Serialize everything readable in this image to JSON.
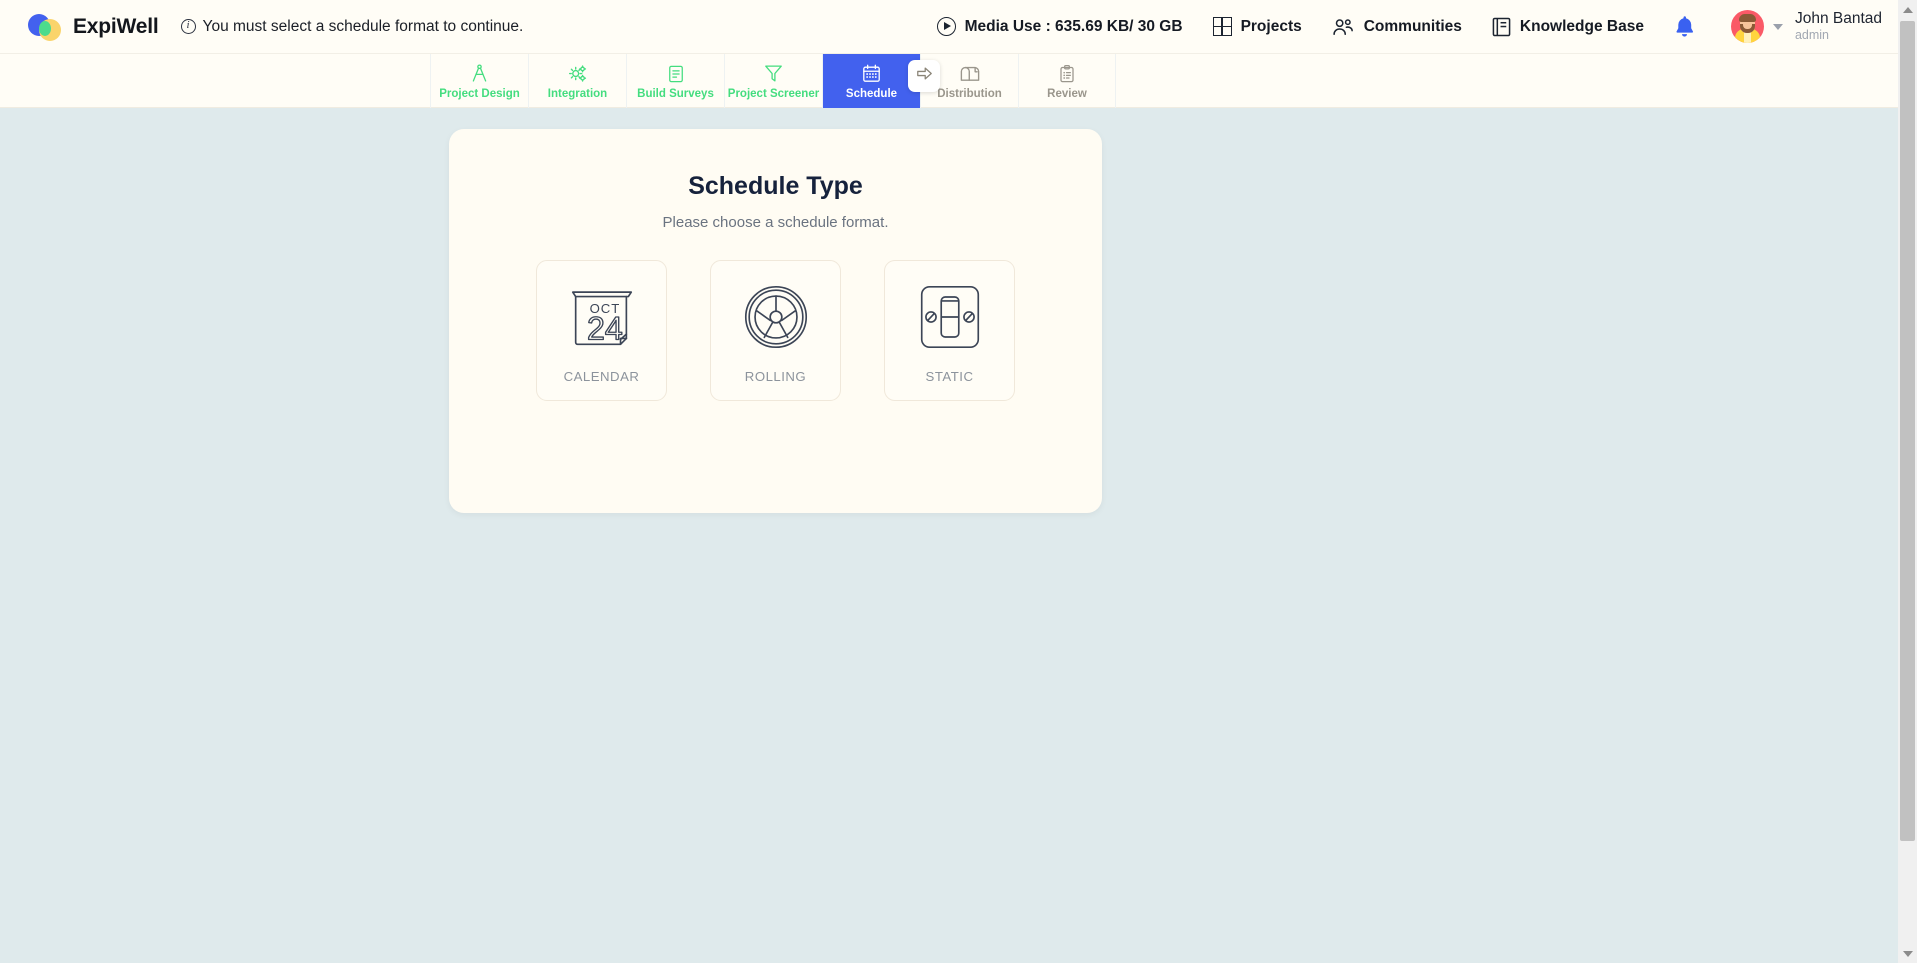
{
  "brand": {
    "name": "ExpiWell",
    "logo_colors": {
      "blue": "#4361ee",
      "yellow": "#fad46b",
      "green": "#4ddb8c"
    }
  },
  "alert": {
    "icon": "info-circle-icon",
    "message": "You must select a schedule format to continue."
  },
  "topnav": {
    "media_use": {
      "icon": "play-circle-icon",
      "label": "Media Use : 635.69 KB/ 30 GB"
    },
    "items": [
      {
        "icon": "grid-icon",
        "label": "Projects"
      },
      {
        "icon": "people-icon",
        "label": "Communities"
      },
      {
        "icon": "book-icon",
        "label": "Knowledge Base"
      }
    ],
    "notifications_icon": "bell-icon",
    "user": {
      "name": "John Bantad",
      "role": "admin",
      "avatar": "user-avatar"
    }
  },
  "stepper": {
    "active_color": "#4261ee",
    "done_color": "#44dd7f",
    "todo_color": "#9a968c",
    "next_button_icon": "arrow-right-icon",
    "steps": [
      {
        "label": "Project Design",
        "icon": "compass-icon",
        "state": "done"
      },
      {
        "label": "Integration",
        "icon": "gears-icon",
        "state": "done"
      },
      {
        "label": "Build Surveys",
        "icon": "document-icon",
        "state": "done"
      },
      {
        "label": "Project Screener",
        "icon": "funnel-icon",
        "state": "done"
      },
      {
        "label": "Schedule",
        "icon": "calendar-icon",
        "state": "active"
      },
      {
        "label": "Distribution",
        "icon": "mailbox-icon",
        "state": "todo"
      },
      {
        "label": "Review",
        "icon": "clipboard-icon",
        "state": "todo"
      }
    ]
  },
  "panel": {
    "title": "Schedule Type",
    "subtitle": "Please choose a schedule format.",
    "options": [
      {
        "label": "CALENDAR",
        "icon": "calendar-date-icon",
        "month": "OCT",
        "day": "24"
      },
      {
        "label": "ROLLING",
        "icon": "wheel-icon"
      },
      {
        "label": "STATIC",
        "icon": "light-switch-icon"
      }
    ]
  },
  "scrollbar": {
    "up_icon": "scroll-up-arrow",
    "down_icon": "scroll-down-arrow"
  }
}
